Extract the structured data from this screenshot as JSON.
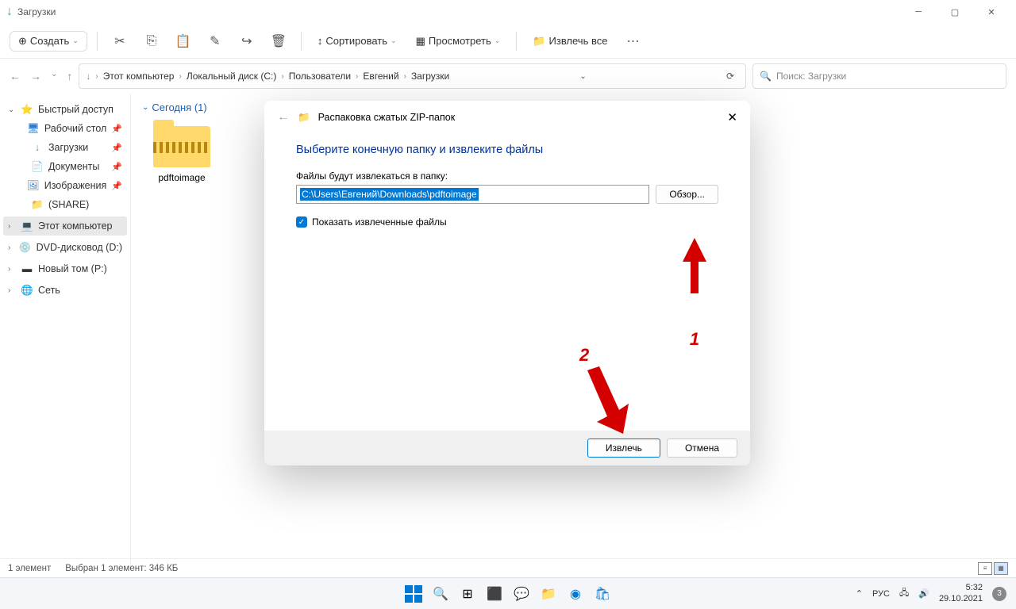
{
  "window": {
    "title": "Загрузки"
  },
  "toolbar": {
    "new": "Создать",
    "sort": "Сортировать",
    "view": "Просмотреть",
    "extract_all": "Извлечь все"
  },
  "breadcrumb": {
    "items": [
      "Этот компьютер",
      "Локальный диск (C:)",
      "Пользователи",
      "Евгений",
      "Загрузки"
    ]
  },
  "search": {
    "placeholder": "Поиск: Загрузки"
  },
  "sidebar": {
    "quick": "Быстрый доступ",
    "desktop": "Рабочий стол",
    "downloads": "Загрузки",
    "documents": "Документы",
    "pictures": "Изображения",
    "share": "(SHARE)",
    "this_pc": "Этот компьютер",
    "dvd": "DVD-дисковод (D:)",
    "volume": "Новый том (P:)",
    "network": "Сеть"
  },
  "content": {
    "group_header": "Сегодня (1)",
    "file_name": "pdftoimage"
  },
  "dialog": {
    "title": "Распаковка сжатых ZIP-папок",
    "heading": "Выберите конечную папку и извлеките файлы",
    "label": "Файлы будут извлекаться в папку:",
    "path": "C:\\Users\\Евгений\\Downloads\\pdftoimage",
    "browse": "Обзор...",
    "show_files": "Показать извлеченные файлы",
    "extract": "Извлечь",
    "cancel": "Отмена"
  },
  "annotations": {
    "n1": "1",
    "n2": "2"
  },
  "status": {
    "count": "1 элемент",
    "selected": "Выбран 1 элемент: 346 КБ"
  },
  "taskbar": {
    "lang": "РУС",
    "time": "5:32",
    "date": "29.10.2021",
    "notif": "3"
  }
}
